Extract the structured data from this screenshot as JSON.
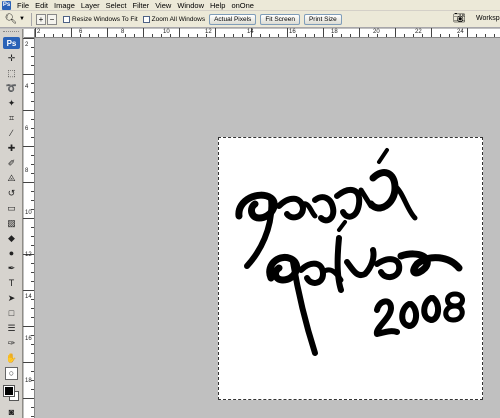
{
  "app": {
    "logo": "Ps"
  },
  "menu": [
    "File",
    "Edit",
    "Image",
    "Layer",
    "Select",
    "Filter",
    "View",
    "Window",
    "Help",
    "onOne"
  ],
  "options": {
    "resize_windows_label": "Resize Windows To Fit",
    "zoom_all_windows_label": "Zoom All Windows",
    "actual_pixels_label": "Actual Pixels",
    "fit_screen_label": "Fit Screen",
    "print_size_label": "Print Size",
    "workspace_label": "Workspace"
  },
  "toolbox": {
    "badge": "Ps",
    "tools": [
      "move-icon",
      "marquee-icon",
      "lasso-icon",
      "magic-wand-icon",
      "crop-icon",
      "slice-icon",
      "healing-brush-icon",
      "brush-icon",
      "clone-stamp-icon",
      "history-brush-icon",
      "eraser-icon",
      "gradient-icon",
      "blur-icon",
      "dodge-icon",
      "pen-icon",
      "type-icon",
      "path-selection-icon",
      "rectangle-icon",
      "notes-icon",
      "eyedropper-icon",
      "hand-icon",
      "zoom-icon"
    ],
    "selected_tool": "zoom-icon",
    "foreground_color": "#000000",
    "background_color": "#ffffff"
  },
  "ruler_labels": {
    "top": [
      "2",
      "6",
      "8",
      "10",
      "12",
      "14",
      "16",
      "18",
      "20",
      "22",
      "24"
    ],
    "left": [
      "2",
      "4",
      "6",
      "8",
      "10",
      "12",
      "14",
      "16",
      "18"
    ]
  },
  "document": {
    "artwork_text": [
      "garcía",
      "gálvez",
      "2008"
    ]
  }
}
